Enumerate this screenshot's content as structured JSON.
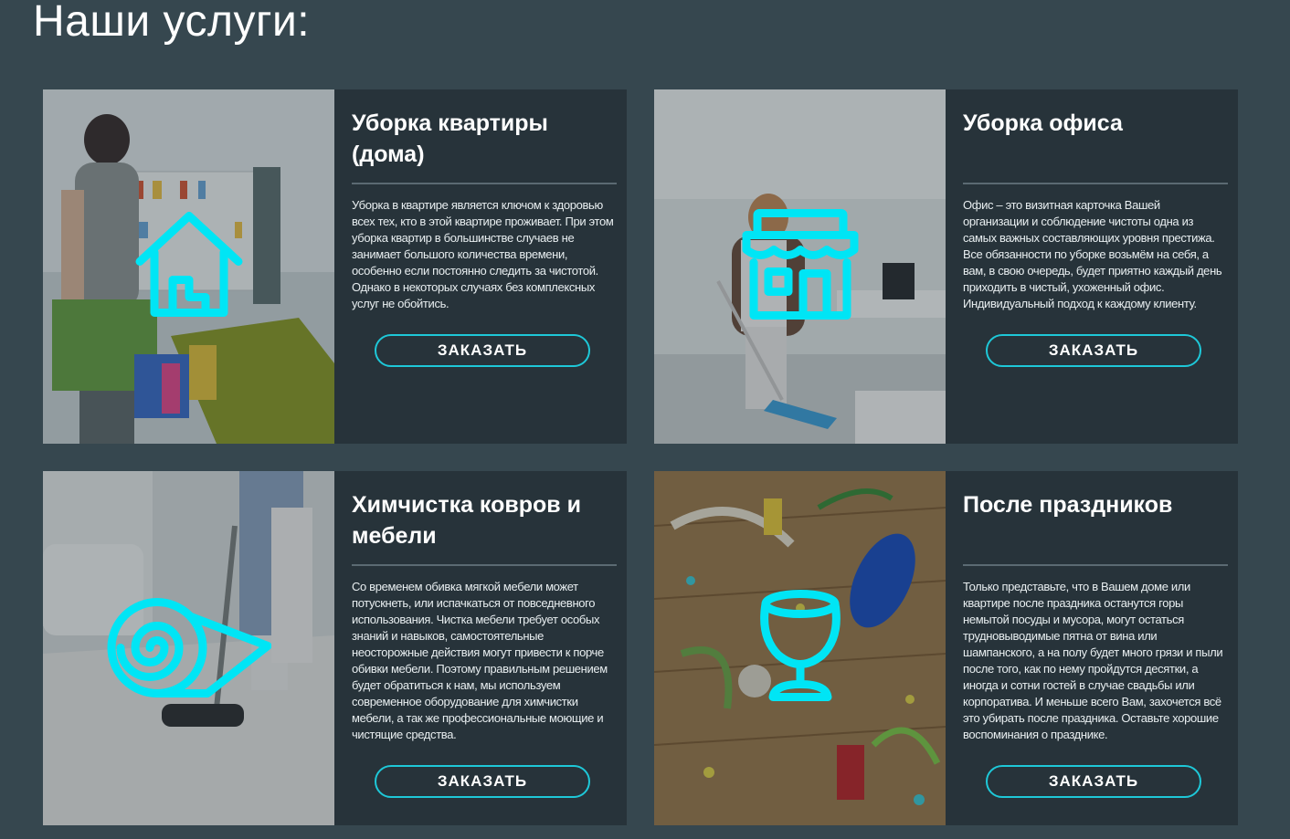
{
  "page": {
    "title": "Наши услуги:"
  },
  "accent_color": "#00e5f5",
  "cards": [
    {
      "title": "Уборка квартиры (дома)",
      "icon": "house-icon",
      "description": "Уборка в квартире является ключом к здоровью всех тех, кто в этой квартире проживает. При этом уборка квартир в большинстве случаев не занимает большого количества времени, особенно если постоянно следить за чистотой. Однако в некоторых случаях без комплексных услуг не обойтись.",
      "button": "ЗАКАЗАТЬ"
    },
    {
      "title": "Уборка офиса",
      "icon": "store-icon",
      "description": "Офис – это визитная карточка Вашей организации и соблюдение чистоты одна из самых важных составляющих уровня престижа. Все обязанности по уборке возьмём на себя, а вам, в свою очередь, будет приятно каждый день приходить в чистый, ухоженный офис. Индивидуальный подход к каждому клиенту.",
      "button": "ЗАКАЗАТЬ"
    },
    {
      "title": "Химчистка ковров и мебели",
      "icon": "carpet-roll-icon",
      "description": "Со временем обивка мягкой мебели может потускнеть, или испачкаться от повседневного использования. Чистка мебели требует особых знаний и навыков, самостоятельные неосторожные действия могут привести к порче обивки мебели. Поэтому правильным решением будет обратиться к нам, мы используем современное оборудование для химчистки мебели, а так же профессиональные моющие и чистящие средства.",
      "button": "ЗАКАЗАТЬ"
    },
    {
      "title": "После праздников",
      "icon": "wine-glass-icon",
      "description": "Только представьте, что в Вашем доме или квартире после праздника останутся горы немытой посуды и мусора, могут остаться трудновыводимые пятна от вина или шампанского, а на полу будет много грязи и пыли после того, как по нему пройдутся десятки, а иногда и сотни гостей в случае свадьбы или корпоратива. И меньше всего Вам, захочется всё это убирать после праздника. Оставьте хорошие воспоминания о празднике.",
      "button": "ЗАКАЗАТЬ"
    }
  ]
}
